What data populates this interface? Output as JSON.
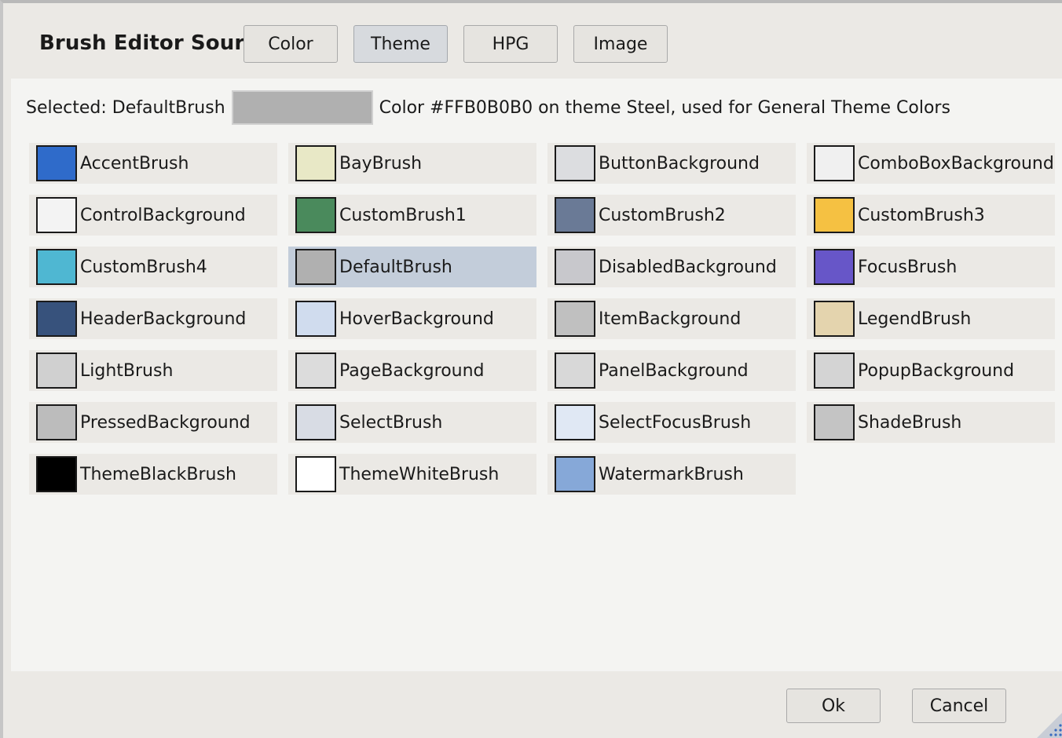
{
  "header": {
    "title": "Brush Editor Source:",
    "sources": [
      {
        "label": "Color",
        "active": false
      },
      {
        "label": "Theme",
        "active": true
      },
      {
        "label": "HPG",
        "active": false
      },
      {
        "label": "Image",
        "active": false
      }
    ]
  },
  "selection": {
    "prefix": "Selected: DefaultBrush",
    "swatch_color": "#B0B0B0",
    "description": "Color #FFB0B0B0 on theme Steel, used for General Theme Colors"
  },
  "brushes": [
    {
      "name": "AccentBrush",
      "color": "#2f6bca"
    },
    {
      "name": "BayBrush",
      "color": "#e8e8c6"
    },
    {
      "name": "ButtonBackground",
      "color": "#dcdde0"
    },
    {
      "name": "ComboBoxBackground",
      "color": "#f0f0f0"
    },
    {
      "name": "ControlBackground",
      "color": "#f3f3f3"
    },
    {
      "name": "CustomBrush1",
      "color": "#4a8a5c"
    },
    {
      "name": "CustomBrush2",
      "color": "#6a7a96"
    },
    {
      "name": "CustomBrush3",
      "color": "#f5c142"
    },
    {
      "name": "CustomBrush4",
      "color": "#4fb7d2"
    },
    {
      "name": "DefaultBrush",
      "color": "#b0b0b0",
      "selected": true
    },
    {
      "name": "DisabledBackground",
      "color": "#c8c8cc"
    },
    {
      "name": "FocusBrush",
      "color": "#6756c8"
    },
    {
      "name": "HeaderBackground",
      "color": "#37527c"
    },
    {
      "name": "HoverBackground",
      "color": "#d0dcee"
    },
    {
      "name": "ItemBackground",
      "color": "#c0c0c0"
    },
    {
      "name": "LegendBrush",
      "color": "#e4d4ae"
    },
    {
      "name": "LightBrush",
      "color": "#d0d0d0"
    },
    {
      "name": "PageBackground",
      "color": "#dcdcdc"
    },
    {
      "name": "PanelBackground",
      "color": "#d8d8d8"
    },
    {
      "name": "PopupBackground",
      "color": "#d4d4d4"
    },
    {
      "name": "PressedBackground",
      "color": "#bcbcbc"
    },
    {
      "name": "SelectBrush",
      "color": "#d8dce4"
    },
    {
      "name": "SelectFocusBrush",
      "color": "#e0e8f4"
    },
    {
      "name": "ShadeBrush",
      "color": "#c4c4c4"
    },
    {
      "name": "ThemeBlackBrush",
      "color": "#000000"
    },
    {
      "name": "ThemeWhiteBrush",
      "color": "#ffffff"
    },
    {
      "name": "WatermarkBrush",
      "color": "#86a8d8"
    }
  ],
  "footer": {
    "ok_label": "Ok",
    "cancel_label": "Cancel"
  }
}
